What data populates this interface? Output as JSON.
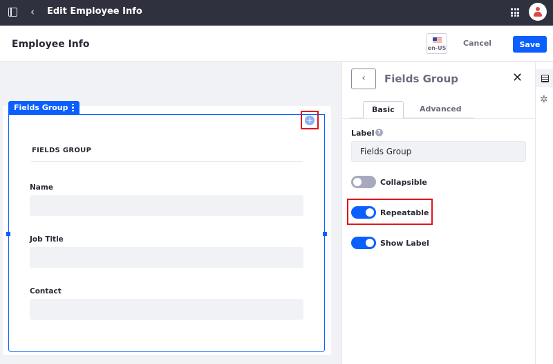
{
  "topbar": {
    "title": "Edit Employee Info",
    "icons": [
      "sidebar-toggle-icon",
      "chevron-left-icon",
      "apps-grid-icon",
      "user-avatar-icon"
    ]
  },
  "header": {
    "page_title": "Employee Info",
    "locale": "en-US",
    "cancel_label": "Cancel",
    "save_label": "Save"
  },
  "canvas": {
    "group_tab_label": "Fields Group",
    "group_heading": "FIELDS GROUP",
    "add_icon": "+",
    "fields": [
      {
        "label": "Name",
        "value": ""
      },
      {
        "label": "Job Title",
        "value": ""
      },
      {
        "label": "Contact",
        "value": ""
      }
    ]
  },
  "panel": {
    "back_icon": "‹",
    "title": "Fields Group",
    "close_icon": "✕",
    "tabs": [
      {
        "label": "Basic",
        "active": true
      },
      {
        "label": "Advanced",
        "active": false
      }
    ],
    "label_title": "Label",
    "help_icon": "?",
    "label_value": "Fields Group",
    "toggles": [
      {
        "label": "Collapsible",
        "on": false
      },
      {
        "label": "Repeatable",
        "on": true
      },
      {
        "label": "Show Label",
        "on": true
      }
    ]
  },
  "rail": {
    "gear_icon": "✲"
  },
  "colors": {
    "accent": "#0b5fff",
    "topbar": "#30313f",
    "highlight": "#e0141e"
  }
}
